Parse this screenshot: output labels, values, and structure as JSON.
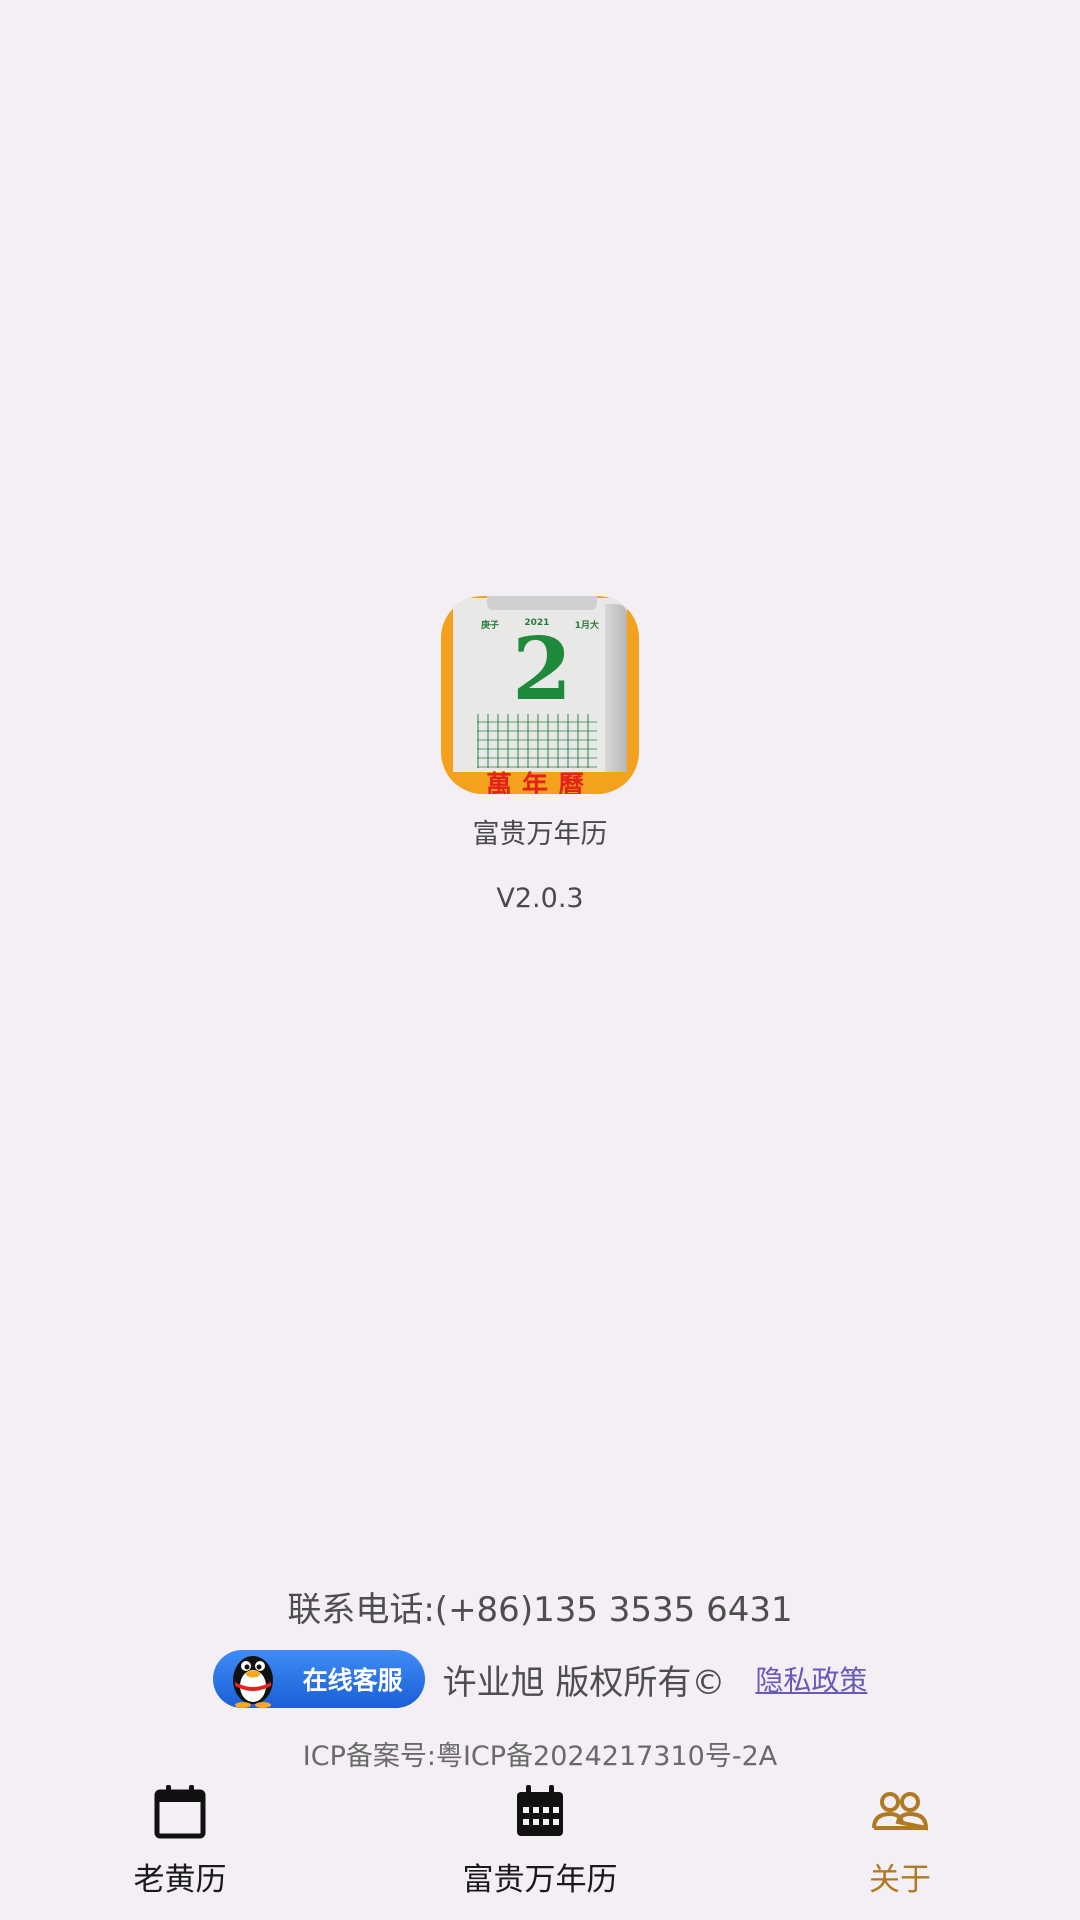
{
  "app": {
    "name": "富贵万年历",
    "version": "V2.0.3",
    "icon_text": {
      "year_left": "庚子",
      "year_mid": "2021",
      "year_right": "1月大",
      "day": "2",
      "bottom": "萬年曆"
    }
  },
  "footer": {
    "contact": "联系电话:(+86)135 3535 6431",
    "qq_service_label": "在线客服",
    "copyright": "许业旭 版权所有©",
    "privacy_link": "隐私政策",
    "icp": "ICP备案号:粤ICP备2024217310号-2A"
  },
  "nav": {
    "items": [
      {
        "label": "老黄历",
        "icon": "calendar-icon",
        "active": false
      },
      {
        "label": "富贵万年历",
        "icon": "calendar-grid-icon",
        "active": false
      },
      {
        "label": "关于",
        "icon": "people-icon",
        "active": true
      }
    ]
  },
  "colors": {
    "background": "#f3eff5",
    "active_tab": "#b07a22",
    "qq_button": "#1a5fd6",
    "privacy_link": "#6a5ab8"
  }
}
